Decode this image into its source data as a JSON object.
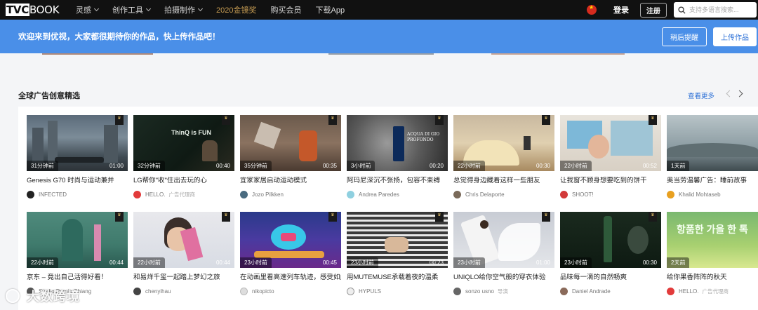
{
  "logo": {
    "prefix": "TVC",
    "suffix": "BOOK"
  },
  "nav": [
    {
      "label": "灵感",
      "dropdown": true
    },
    {
      "label": "创作工具",
      "dropdown": true
    },
    {
      "label": "拍摄制作",
      "dropdown": true
    },
    {
      "label": "2020金镜奖",
      "dropdown": false,
      "highlight": true
    },
    {
      "label": "购买会员",
      "dropdown": false
    },
    {
      "label": "下载App",
      "dropdown": false
    }
  ],
  "header": {
    "login": "登录",
    "register": "注册",
    "search_placeholder": "支持多语言搜索..."
  },
  "banner": {
    "text": "欢迎来到优视，大家都很期待你的作品，快上传作品吧！",
    "later": "稍后提醒",
    "upload": "上传作品"
  },
  "section": {
    "title": "全球广告创意精选",
    "see_more": "查看更多"
  },
  "colors": {
    "accent": "#4a8fe8",
    "link": "#2b6fd6",
    "gold": "#c59b52",
    "nav_bg": "#111111"
  },
  "row1": [
    {
      "ago": "31分钟前",
      "duration": "01:00",
      "title": "Genesis G70 时尚与运动兼并",
      "author": "INFECTED",
      "tag": ""
    },
    {
      "ago": "32分钟前",
      "duration": "00:40",
      "title": "LG帮你\"收\"住出去玩的心",
      "author": "HELLO.",
      "tag": "广告代理商",
      "overlay": "ThinQ is FUN"
    },
    {
      "ago": "35分钟前",
      "duration": "00:35",
      "title": "宜家家居启动运动模式",
      "author": "Jozo Pilkken",
      "tag": ""
    },
    {
      "ago": "3小时前",
      "duration": "00:20",
      "title": "阿玛尼深沉不张扬，包容不束缚",
      "author": "Andrea Paredes",
      "tag": "",
      "overlay": "ACQUA DI GIO PROFONDO"
    },
    {
      "ago": "22小时前",
      "duration": "00:30",
      "title": "总觉得身边藏着这样一些朋友",
      "author": "Chris Delaporte",
      "tag": ""
    },
    {
      "ago": "22小时前",
      "duration": "00:52",
      "title": "让我窗不顾身想要吃到的饼干",
      "author": "SHOOT!",
      "tag": ""
    },
    {
      "ago": "1天前",
      "duration": "",
      "title": "奥当劳温馨广告：睡前故事",
      "author": "Khalid Mohtaseb",
      "tag": ""
    }
  ],
  "row2": [
    {
      "ago": "22小时前",
      "duration": "00:44",
      "title": "京东 – 竟出自己活得好看！",
      "author": "Studio Pamio Chiang",
      "tag": ""
    },
    {
      "ago": "22小时前",
      "duration": "00:44",
      "title": "和易烊千玺一起踏上梦幻之旅",
      "author": "chenyihau",
      "tag": ""
    },
    {
      "ago": "23小时前",
      "duration": "00:45",
      "title": "在动画里看高速列车轨迹，感受如此...",
      "author": "nikopicto",
      "tag": ""
    },
    {
      "ago": "23小时前",
      "duration": "00:23",
      "title": "用MUTEMUSE承载着夜的温柔",
      "author": "HYPULS",
      "tag": ""
    },
    {
      "ago": "23小时前",
      "duration": "01:00",
      "title": "UNIQLO给你空气般的穿衣体验",
      "author": "sonzo usno",
      "tag": "导演"
    },
    {
      "ago": "23小时前",
      "duration": "00:30",
      "title": "品味每一滴的自然畅爽",
      "author": "Daniel Andrade",
      "tag": ""
    },
    {
      "ago": "2天前",
      "duration": "",
      "title": "给你果香阵阵的秋天",
      "author": "HELLO.",
      "tag": "广告代理商",
      "overlay": "항품한 가을 한 톡"
    }
  ],
  "watermark": "大数跨境"
}
